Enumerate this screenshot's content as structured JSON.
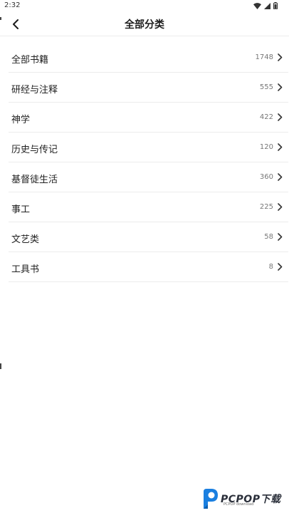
{
  "status": {
    "time": "2:32",
    "icons": [
      "wifi-icon",
      "signal-icon",
      "battery-icon"
    ]
  },
  "header": {
    "title": "全部分类",
    "back_icon": "chevron-left-icon"
  },
  "categories": [
    {
      "name": "全部书籍",
      "count": "1748"
    },
    {
      "name": "研经与注释",
      "count": "555"
    },
    {
      "name": "神学",
      "count": "422"
    },
    {
      "name": "历史与传记",
      "count": "120"
    },
    {
      "name": "基督徒生活",
      "count": "360"
    },
    {
      "name": "事工",
      "count": "225"
    },
    {
      "name": "文艺类",
      "count": "58"
    },
    {
      "name": "工具书",
      "count": "8"
    }
  ],
  "watermark": {
    "text": "PCPOP下载",
    "sub": "PCPOP download"
  },
  "colors": {
    "text": "#222222",
    "count": "#777777",
    "divider": "#ececec",
    "background": "#ffffff",
    "watermark_blue": "#1a7fe0"
  }
}
